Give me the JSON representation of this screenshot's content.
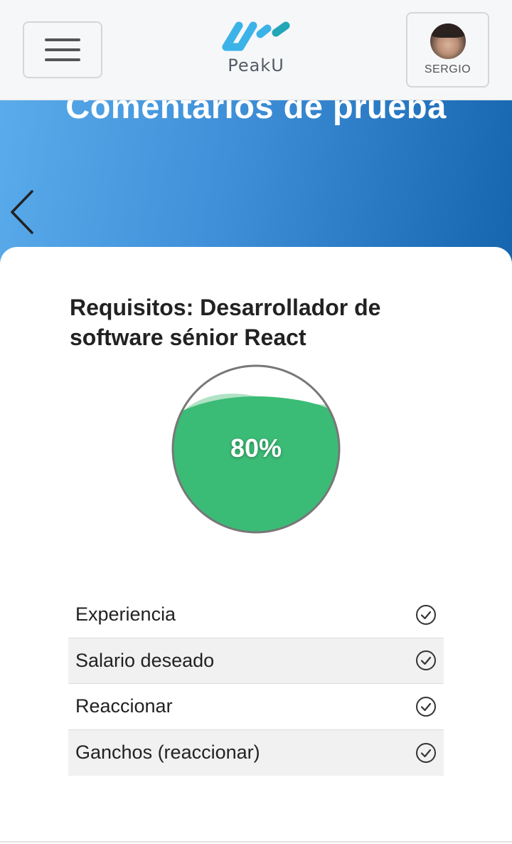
{
  "header": {
    "logo_text": "PeakU",
    "user_name": "SERGIO",
    "menu_icon": "hamburger-icon",
    "logo_icon": "peaku-logo-icon"
  },
  "hero": {
    "title": "Comentarios de prueba",
    "back_icon": "chevron-left-icon"
  },
  "requirements": {
    "title": "Requisitos: Desarrollador de software sénior React",
    "match": {
      "label": "80%",
      "value": 0.8
    },
    "items": [
      {
        "label": "Experiencia",
        "status_icon": "check-circle-icon"
      },
      {
        "label": "Salario deseado",
        "status_icon": "check-circle-icon"
      },
      {
        "label": "Reaccionar",
        "status_icon": "check-circle-icon"
      },
      {
        "label": "Ganchos (reaccionar)",
        "status_icon": "check-circle-icon"
      }
    ]
  },
  "colors": {
    "accent_blue": "#1565ae",
    "gauge_green": "#3bbc76",
    "gauge_green_light": "#b1e2c5",
    "logo_blue": "#3bb3e8"
  }
}
